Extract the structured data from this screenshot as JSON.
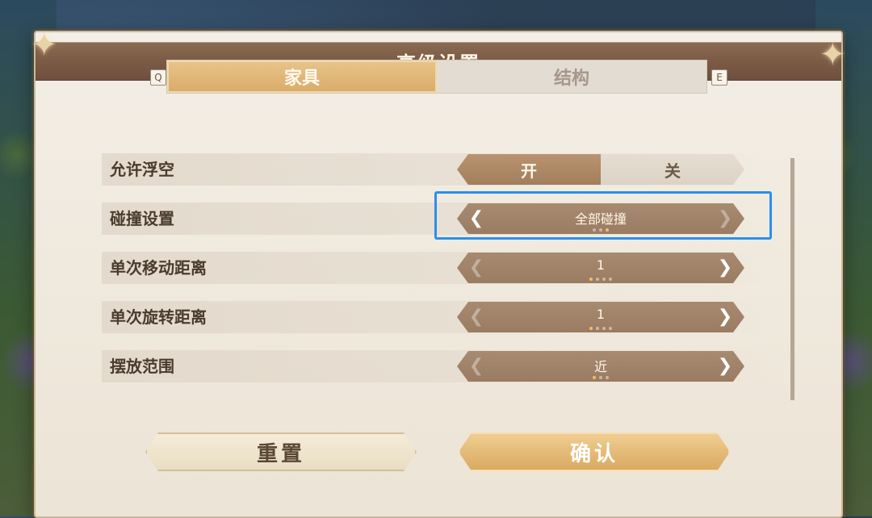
{
  "window": {
    "title": "高级设置"
  },
  "tabs": {
    "prev_key": "Q",
    "next_key": "E",
    "items": [
      {
        "label": "家具",
        "active": true
      },
      {
        "label": "结构",
        "active": false
      }
    ]
  },
  "settings": {
    "allow_float": {
      "label": "允许浮空",
      "on_label": "开",
      "off_label": "关",
      "selected": "开"
    },
    "collision": {
      "label": "碰撞设置",
      "value": "全部碰撞",
      "option_count": 3,
      "option_index": 3
    },
    "move_distance": {
      "label": "单次移动距离",
      "value": "1",
      "option_count": 4,
      "option_index": 1
    },
    "rotate_distance": {
      "label": "单次旋转距离",
      "value": "1",
      "option_count": 4,
      "option_index": 1
    },
    "place_range": {
      "label": "摆放范围",
      "value": "近",
      "option_count": 3,
      "option_index": 1
    }
  },
  "buttons": {
    "reset": "重置",
    "confirm": "确认"
  },
  "icons": {
    "left_arrow": "chevron-left-icon",
    "right_arrow": "chevron-right-icon",
    "corner": "star-ornament-icon"
  },
  "colors": {
    "accent": "#d9ab68",
    "focus": "#2a8ff0",
    "selector": "#a88a70"
  }
}
